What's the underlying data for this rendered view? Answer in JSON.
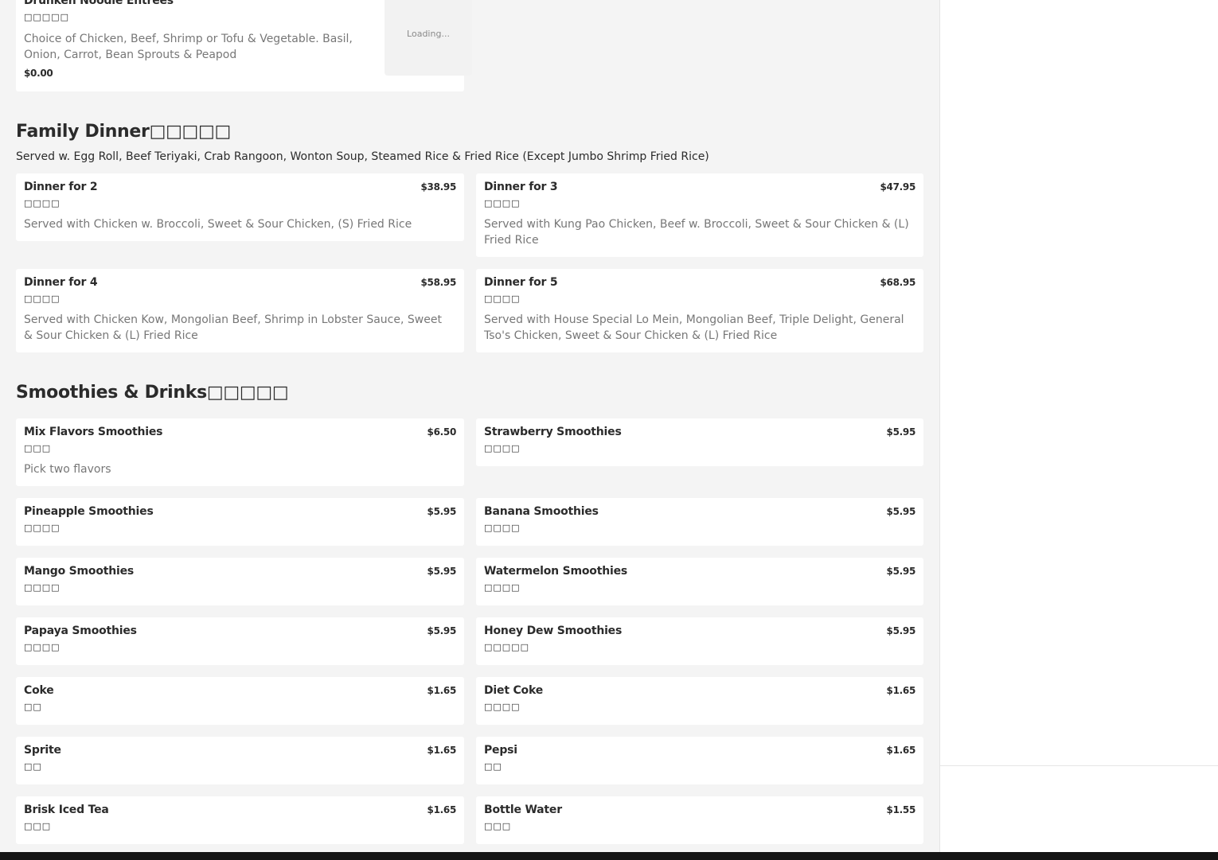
{
  "top_item": {
    "name": "Drunken Noodle Entrees",
    "sub": "□□□□□",
    "desc": "Choice of Chicken, Beef, Shrimp or Tofu & Vegetable. Basil, Onion, Carrot, Bean Sprouts & Peapod",
    "price": "$0.00",
    "image_status": "Loading..."
  },
  "family": {
    "title": "Family Dinner□□□□□",
    "desc": "Served w. Egg Roll, Beef Teriyaki, Crab Rangoon, Wonton Soup, Steamed Rice & Fried Rice (Except Jumbo Shrimp Fried Rice)",
    "items": [
      {
        "name": "Dinner for 2",
        "sub": "□□□□",
        "price": "$38.95",
        "desc": "Served with Chicken w. Broccoli, Sweet & Sour Chicken, (S) Fried Rice"
      },
      {
        "name": "Dinner for 3",
        "sub": "□□□□",
        "price": "$47.95",
        "desc": "Served with Kung Pao Chicken, Beef w. Broccoli, Sweet & Sour Chicken & (L) Fried Rice"
      },
      {
        "name": "Dinner for 4",
        "sub": "□□□□",
        "price": "$58.95",
        "desc": "Served with Chicken Kow, Mongolian Beef, Shrimp in Lobster Sauce, Sweet & Sour Chicken & (L) Fried Rice"
      },
      {
        "name": "Dinner for 5",
        "sub": "□□□□",
        "price": "$68.95",
        "desc": "Served with House Special Lo Mein, Mongolian Beef, Triple Delight, General Tso's Chicken, Sweet & Sour Chicken & (L) Fried Rice"
      }
    ]
  },
  "drinks": {
    "title": "Smoothies & Drinks□□□□□",
    "items": [
      {
        "name": "Mix Flavors Smoothies",
        "sub": "□□□",
        "price": "$6.50",
        "desc": "Pick two flavors"
      },
      {
        "name": "Strawberry Smoothies",
        "sub": "□□□□",
        "price": "$5.95"
      },
      {
        "name": "Pineapple Smoothies",
        "sub": "□□□□",
        "price": "$5.95"
      },
      {
        "name": "Banana Smoothies",
        "sub": "□□□□",
        "price": "$5.95"
      },
      {
        "name": "Mango Smoothies",
        "sub": "□□□□",
        "price": "$5.95"
      },
      {
        "name": "Watermelon Smoothies",
        "sub": "□□□□",
        "price": "$5.95"
      },
      {
        "name": "Papaya Smoothies",
        "sub": "□□□□",
        "price": "$5.95"
      },
      {
        "name": "Honey Dew Smoothies",
        "sub": "□□□□□",
        "price": "$5.95"
      },
      {
        "name": "Coke",
        "sub": "□□",
        "price": "$1.65"
      },
      {
        "name": "Diet Coke",
        "sub": "□□□□",
        "price": "$1.65"
      },
      {
        "name": "Sprite",
        "sub": "□□",
        "price": "$1.65"
      },
      {
        "name": "Pepsi",
        "sub": "□□",
        "price": "$1.65"
      },
      {
        "name": "Brisk Iced Tea",
        "sub": "□□□",
        "price": "$1.65"
      },
      {
        "name": "Bottle Water",
        "sub": "□□□",
        "price": "$1.55"
      }
    ]
  }
}
